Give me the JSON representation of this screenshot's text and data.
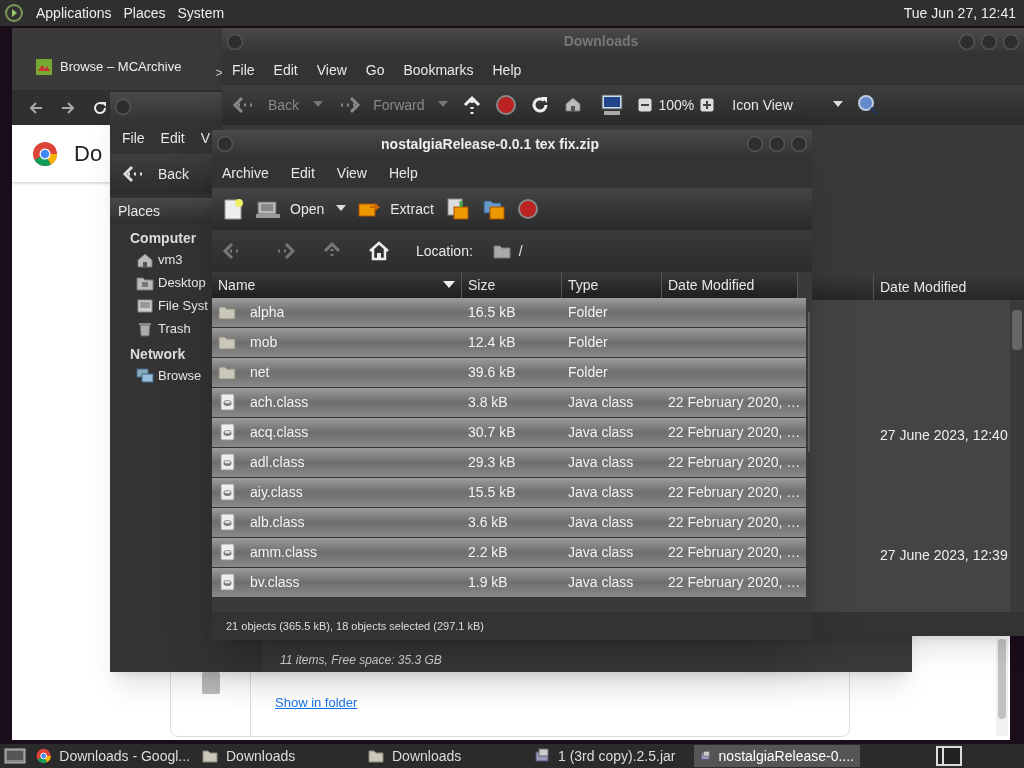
{
  "top_panel": {
    "menus": [
      "Applications",
      "Places",
      "System"
    ],
    "clock": "Tue Jun 27, 12:41"
  },
  "browser": {
    "tab_title": "Browse – MCArchive",
    "tab_overflow": ">",
    "page_heading": "Do",
    "link": "Show in folder"
  },
  "file_manager_back": {
    "menus": [
      "File",
      "Edit",
      "V"
    ],
    "back_label": "Back",
    "sidebar_header": "Places",
    "sections": [
      {
        "title": "Computer",
        "items": [
          {
            "kind": "home",
            "label": "vm3"
          },
          {
            "kind": "desktop",
            "label": "Desktop"
          },
          {
            "kind": "drive",
            "label": "File Syst"
          },
          {
            "kind": "trash",
            "label": "Trash"
          }
        ]
      },
      {
        "title": "Network",
        "items": [
          {
            "kind": "network",
            "label": "Browse"
          }
        ]
      }
    ],
    "status": "11 items, Free space: 35.3 GB"
  },
  "downloads_window": {
    "title": "Downloads",
    "menus": [
      "File",
      "Edit",
      "View",
      "Go",
      "Bookmarks",
      "Help"
    ],
    "toolbar": {
      "back": "Back",
      "forward": "Forward",
      "zoom": "100%",
      "view": "Icon View"
    },
    "column_header": "Date Modified",
    "rows": [
      {},
      {},
      {},
      {},
      {
        "date_modified": "27 June 2023, 12:40"
      },
      {},
      {},
      {},
      {
        "date_modified": "27 June 2023, 12:39"
      }
    ]
  },
  "archive_window": {
    "title": "nostalgiaRelease-0.0.1 tex fix.zip",
    "menus": [
      "Archive",
      "Edit",
      "View",
      "Help"
    ],
    "toolbar": {
      "open": "Open",
      "extract": "Extract"
    },
    "location_label": "Location:",
    "location": "/",
    "columns": [
      "Name",
      "Size",
      "Type",
      "Date Modified"
    ],
    "rows": [
      {
        "kind": "folder",
        "name": "alpha",
        "size": "16.5 kB",
        "type": "Folder",
        "selected": true
      },
      {
        "kind": "folder",
        "name": "mob",
        "size": "12.4 kB",
        "type": "Folder",
        "selected": true
      },
      {
        "kind": "folder",
        "name": "net",
        "size": "39.6 kB",
        "type": "Folder",
        "selected": true
      },
      {
        "kind": "file",
        "name": "ach.class",
        "size": "3.8 kB",
        "type": "Java class",
        "date": "22 February 2020, …",
        "selected": true
      },
      {
        "kind": "file",
        "name": "acq.class",
        "size": "30.7 kB",
        "type": "Java class",
        "date": "22 February 2020, …",
        "selected": true
      },
      {
        "kind": "file",
        "name": "adl.class",
        "size": "29.3 kB",
        "type": "Java class",
        "date": "22 February 2020, …",
        "selected": true
      },
      {
        "kind": "file",
        "name": "aiy.class",
        "size": "15.5 kB",
        "type": "Java class",
        "date": "22 February 2020, …",
        "selected": true
      },
      {
        "kind": "file",
        "name": "alb.class",
        "size": "3.6 kB",
        "type": "Java class",
        "date": "22 February 2020, …",
        "selected": true
      },
      {
        "kind": "file",
        "name": "amm.class",
        "size": "2.2 kB",
        "type": "Java class",
        "date": "22 February 2020, …",
        "selected": true
      },
      {
        "kind": "file",
        "name": "bv.class",
        "size": "1.9 kB",
        "type": "Java class",
        "date": "22 February 2020, …",
        "selected": true
      }
    ],
    "status": "21 objects (365.5 kB), 18 objects selected (297.1 kB)"
  },
  "taskbar": [
    {
      "kind": "browser",
      "label": "Downloads - Googl...",
      "selected": false
    },
    {
      "kind": "folder",
      "label": "Downloads",
      "selected": false
    },
    {
      "kind": "folder",
      "label": "Downloads",
      "selected": false
    },
    {
      "kind": "archive",
      "label": "1 (3rd copy).2.5.jar",
      "selected": false
    },
    {
      "kind": "archive",
      "label": "nostalgiaRelease-0....",
      "selected": true
    }
  ]
}
